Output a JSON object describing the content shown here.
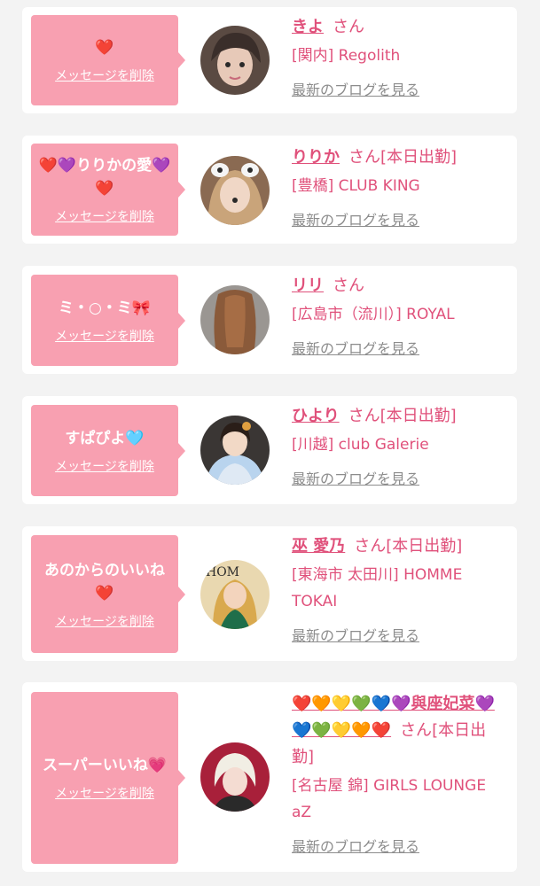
{
  "delete_label": "メッセージを削除",
  "blog_label": "最新のブログを見る",
  "cards": [
    {
      "message": "❤️",
      "name": "きよ",
      "suffix": "さん",
      "status": "",
      "shop": "[関内] Regolith"
    },
    {
      "message": "❤️💜りりかの愛💜❤️",
      "name": "りりか",
      "suffix": "さん",
      "status": "[本日出勤]",
      "shop": "[豊橋] CLUB KING"
    },
    {
      "message": "ミ・○・ミ🎀",
      "name": "リリ",
      "suffix": "さん",
      "status": "",
      "shop": "[広島市（流川）] ROYAL"
    },
    {
      "message": "すぱぴよ🩵",
      "name": "ひより",
      "suffix": "さん",
      "status": "[本日出勤]",
      "shop": "[川越] club Galerie"
    },
    {
      "message": "あのからのいいね❤️",
      "name": "巫 愛乃",
      "suffix": "さん",
      "status": "[本日出勤]",
      "shop": "[東海市 太田川] HOMME TOKAI"
    },
    {
      "message": "スーパーいいね💗",
      "name": "❤️🧡💛💚💙💜與座妃菜💜💙💚💛🧡❤️",
      "suffix": "さん",
      "status": "[本日出勤]",
      "shop": "[名古屋 錦] GIRLS LOUNGE aZ"
    }
  ],
  "colors": {
    "page_bg": "#f3f3f3",
    "bubble": "#f8a0b1",
    "accent": "#e0517b",
    "link_gray": "#8c8c8c"
  }
}
